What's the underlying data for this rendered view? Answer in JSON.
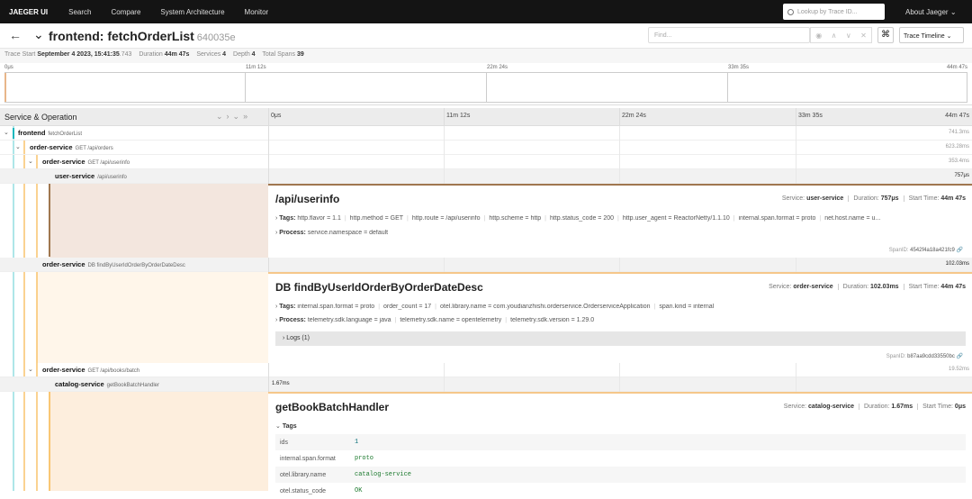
{
  "nav": {
    "brand": "JAEGER UI",
    "items": [
      "Search",
      "Compare",
      "System Architecture",
      "Monitor"
    ],
    "lookup_placeholder": "Lookup by Trace ID...",
    "about": "About Jaeger ⌄"
  },
  "header": {
    "service": "frontend: fetchOrderList",
    "trace_id": "640035e",
    "find_placeholder": "Find...",
    "view_mode": "Trace Timeline ⌄"
  },
  "summary": {
    "start_label": "Trace Start",
    "start_value": "September 4 2023, 15:41:35",
    "start_ms": ".743",
    "duration_label": "Duration",
    "duration_value": "44m 47s",
    "services_label": "Services",
    "services_value": "4",
    "depth_label": "Depth",
    "depth_value": "4",
    "spans_label": "Total Spans",
    "spans_value": "39"
  },
  "ticks": [
    "0μs",
    "11m 12s",
    "22m 24s",
    "33m 35s",
    "44m 47s"
  ],
  "span_header": {
    "title": "Service & Operation"
  },
  "rows": [
    {
      "service": "frontend",
      "op": "fetchOrderList",
      "dur": "741.3ms",
      "color": "#17b8be"
    },
    {
      "service": "order-service",
      "op": "GET /api/orders",
      "dur": "623.28ms",
      "color": "#f5a623"
    },
    {
      "service": "order-service",
      "op": "GET /api/userinfo",
      "dur": "353.4ms",
      "color": "#f5a623"
    },
    {
      "service": "user-service",
      "op": "/api/userinfo",
      "dur": "757μs",
      "color": "#a0774f"
    },
    {
      "service": "order-service",
      "op": "DB findByUserIdOrderByOrderDateDesc",
      "dur": "102.03ms",
      "color": "#f5a623"
    },
    {
      "service": "order-service",
      "op": "GET /api/books/batch",
      "dur": "19.52ms",
      "color": "#f5a623"
    },
    {
      "service": "catalog-service",
      "op": "getBookBatchHandler",
      "dur": "1.67ms",
      "color": "#f5a623"
    }
  ],
  "detail1": {
    "title": "/api/userinfo",
    "service_label": "Service:",
    "service": "user-service",
    "duration_label": "Duration:",
    "duration": "757μs",
    "start_label": "Start Time:",
    "start": "44m 47s",
    "tags_label": "Tags:",
    "tags": [
      "http.flavor = 1.1",
      "http.method = GET",
      "http.route = /api/userinfo",
      "http.scheme = http",
      "http.status_code = 200",
      "http.user_agent = ReactorNetty/1.1.10",
      "internal.span.format = proto",
      "net.host.name = u..."
    ],
    "process_label": "Process:",
    "process": [
      "service.namespace = default"
    ],
    "spanid_label": "SpanID:",
    "spanid": "4542f4a18a421fc9"
  },
  "detail2": {
    "title": "DB findByUserIdOrderByOrderDateDesc",
    "service_label": "Service:",
    "service": "order-service",
    "duration_label": "Duration:",
    "duration": "102.03ms",
    "start_label": "Start Time:",
    "start": "44m 47s",
    "tags_label": "Tags:",
    "tags": [
      "internal.span.format = proto",
      "order_count = 17",
      "otel.library.name = com.youdianzhishi.orderservice.OrderserviceApplication",
      "span.kind = internal"
    ],
    "process_label": "Process:",
    "process": [
      "telemetry.sdk.language = java",
      "telemetry.sdk.name = opentelemetry",
      "telemetry.sdk.version = 1.29.0"
    ],
    "logs_label": "Logs (1)",
    "spanid_label": "SpanID:",
    "spanid": "b87aa9cdd33550bc"
  },
  "detail3": {
    "title": "getBookBatchHandler",
    "service_label": "Service:",
    "service": "catalog-service",
    "duration_label": "Duration:",
    "duration": "1.67ms",
    "start_label": "Start Time:",
    "start": "0μs",
    "tags_label": "Tags",
    "tag_rows": [
      {
        "k": "ids",
        "v": "1"
      },
      {
        "k": "internal.span.format",
        "v": "proto"
      },
      {
        "k": "otel.library.name",
        "v": "catalog-service"
      },
      {
        "k": "otel.status_code",
        "v": "OK"
      }
    ]
  }
}
